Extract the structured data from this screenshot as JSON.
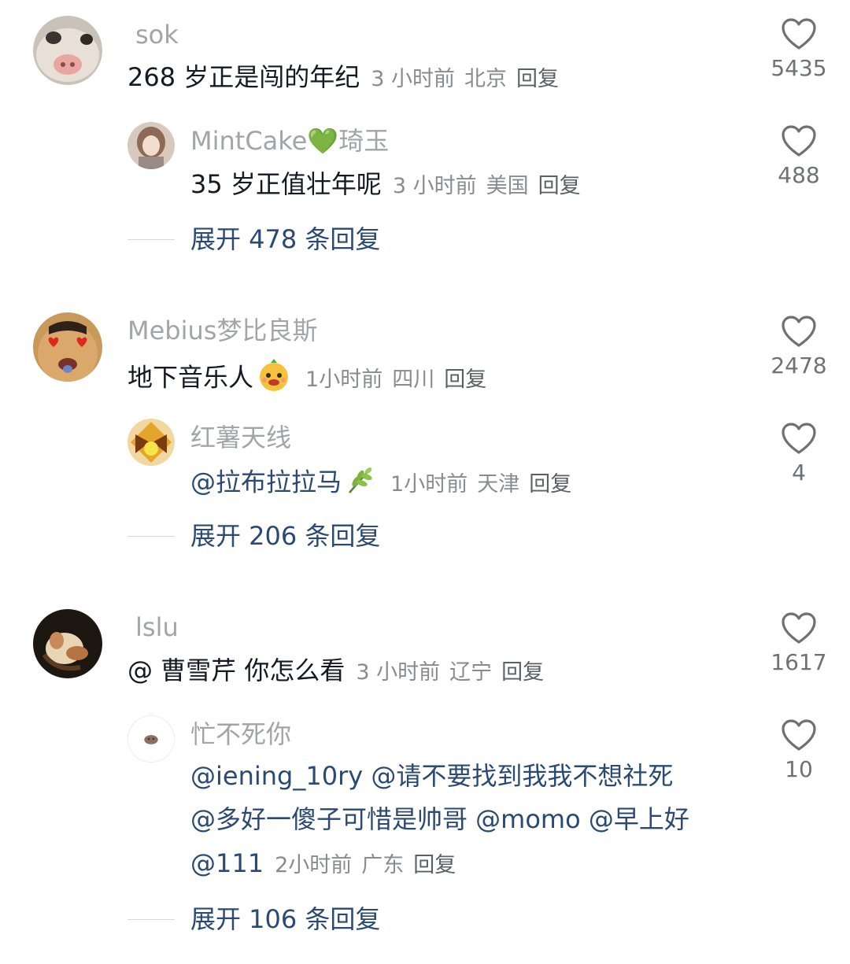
{
  "comments": [
    {
      "username": "sok",
      "text": "268 岁正是闯的年纪",
      "time": "3 小时前",
      "location": "北京",
      "reply_label": "回复",
      "likes": "5435",
      "reply": {
        "username": "MintCake",
        "username_emoji": "💚",
        "username_suffix": "琦玉",
        "text": "35 岁正值壮年呢",
        "time": "3 小时前",
        "location": "美国",
        "reply_label": "回复",
        "likes": "488"
      },
      "expand_label": "展开 478 条回复"
    },
    {
      "username": "Mebius梦比良斯",
      "text": "地下音乐人",
      "text_emoji": "😊",
      "time": "1小时前",
      "location": "四川",
      "reply_label": "回复",
      "likes": "2478",
      "reply": {
        "username": "红薯天线",
        "text": "@拉布拉拉马",
        "text_emoji": "🌿",
        "time": "1小时前",
        "location": "天津",
        "reply_label": "回复",
        "likes": "4"
      },
      "expand_label": "展开 206 条回复"
    },
    {
      "username": "lslu",
      "text": "@ 曹雪芹 你怎么看",
      "time": "3 小时前",
      "location": "辽宁",
      "reply_label": "回复",
      "likes": "1617",
      "reply": {
        "username": "忙不死你",
        "line1": "@iening_10ry @请不要找到我我不想社死",
        "line2": "@多好一傻子可惜是帅哥 @momo @早上好",
        "line3": "@111",
        "time": "2小时前",
        "location": "广东",
        "reply_label": "回复",
        "likes": "10"
      },
      "expand_label": "展开 106 条回复"
    }
  ],
  "icons": {
    "like": "heart-outline-icon"
  },
  "colors": {
    "link": "#2a4a73",
    "muted": "#a3a4a8",
    "text": "#161823"
  }
}
